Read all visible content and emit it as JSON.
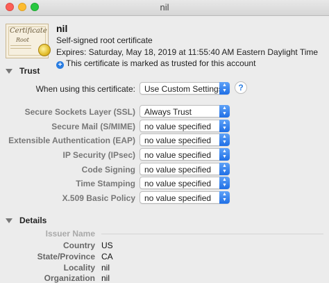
{
  "window": {
    "title": "nil"
  },
  "cert": {
    "icon_title": "Certificate",
    "icon_root": "Root",
    "name": "nil",
    "type": "Self-signed root certificate",
    "expires": "Expires: Saturday, May 18, 2019 at 11:55:40 AM Eastern Daylight Time",
    "trusted_note": "This certificate is marked as trusted for this account"
  },
  "trust": {
    "section_label": "Trust",
    "using_label": "When using this certificate:",
    "using_value": "Use Custom Settings",
    "help_label": "?",
    "rows": [
      {
        "label": "Secure Sockets Layer (SSL)",
        "value": "Always Trust"
      },
      {
        "label": "Secure Mail (S/MIME)",
        "value": "no value specified"
      },
      {
        "label": "Extensible Authentication (EAP)",
        "value": "no value specified"
      },
      {
        "label": "IP Security (IPsec)",
        "value": "no value specified"
      },
      {
        "label": "Code Signing",
        "value": "no value specified"
      },
      {
        "label": "Time Stamping",
        "value": "no value specified"
      },
      {
        "label": "X.509 Basic Policy",
        "value": "no value specified"
      }
    ]
  },
  "details": {
    "section_label": "Details",
    "issuer_label": "Issuer Name",
    "rows": [
      {
        "label": "Country",
        "value": "US"
      },
      {
        "label": "State/Province",
        "value": "CA"
      },
      {
        "label": "Locality",
        "value": "nil"
      },
      {
        "label": "Organization",
        "value": "nil"
      }
    ]
  },
  "colors": {
    "accent": "#2a7de1",
    "close": "#fc5f57",
    "minimize": "#fdbc2e",
    "maximize": "#28c840"
  },
  "icons": {
    "plus": "plus-circle-icon",
    "seal": "certificate-seal-icon"
  }
}
